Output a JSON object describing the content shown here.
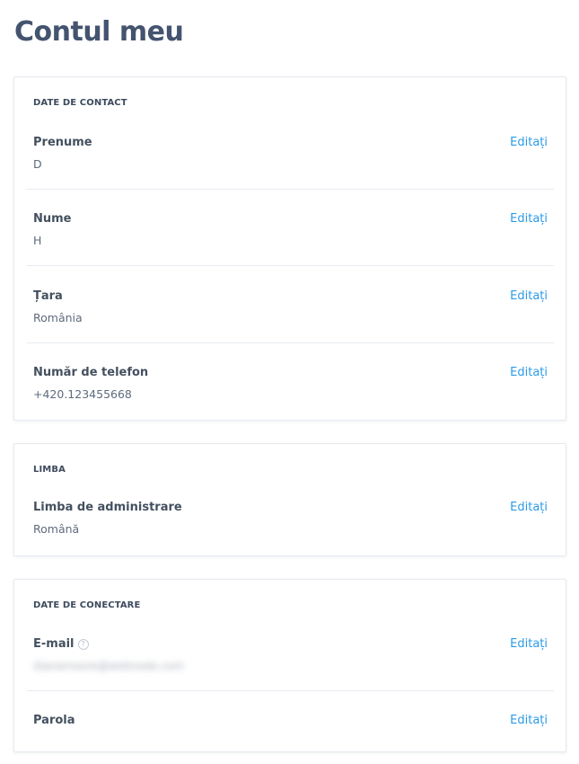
{
  "page": {
    "title": "Contul meu"
  },
  "contact_section": {
    "header": "DATE DE CONTACT",
    "fields": [
      {
        "label": "Prenume",
        "value": "D",
        "edit_label": "Editați"
      },
      {
        "label": "Nume",
        "value": "H",
        "edit_label": "Editați"
      },
      {
        "label": "Țara",
        "value": "România",
        "edit_label": "Editați"
      },
      {
        "label": "Număr de telefon",
        "value": "+420.123455668",
        "edit_label": "Editați"
      }
    ]
  },
  "language_section": {
    "header": "LIMBA",
    "fields": [
      {
        "label": "Limba de administrare",
        "value": "Română",
        "edit_label": "Editați"
      }
    ]
  },
  "login_section": {
    "header": "DATE DE CONECTARE",
    "fields": [
      {
        "label": "E-mail",
        "value": "dianamoore@webnode.com",
        "edit_label": "Editați",
        "help_icon": "question-circle-icon",
        "help_glyph": "?"
      },
      {
        "label": "Parola",
        "edit_label": "Editați"
      }
    ]
  },
  "colors": {
    "title": "#44546f",
    "link": "#2b9be8",
    "border": "#e6eaf0"
  }
}
